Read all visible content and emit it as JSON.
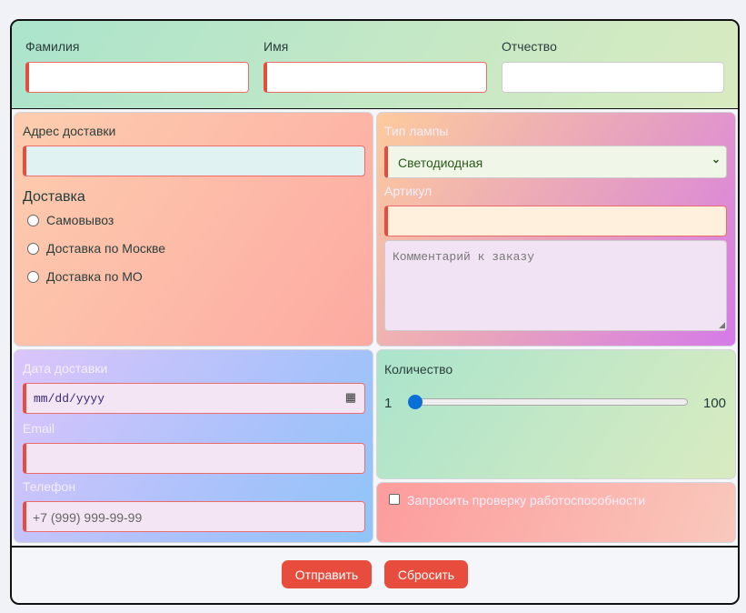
{
  "name": {
    "last_name_label": "Фамилия",
    "first_name_label": "Имя",
    "patronymic_label": "Отчество"
  },
  "delivery": {
    "address_label": "Адрес доставки",
    "method_title": "Доставка",
    "options": [
      "Самовывоз",
      "Доставка по Москве",
      "Доставка по МО"
    ]
  },
  "lamp": {
    "type_label": "Тип лампы",
    "type_value": "Светодиодная",
    "article_label": "Артикул",
    "comment_placeholder": "Комментарий к заказу"
  },
  "contact": {
    "date_label": "Дата доставки",
    "date_placeholder": "mm/dd/yyyy",
    "email_label": "Email",
    "phone_label": "Телефон",
    "phone_placeholder": "+7 (999) 999-99-99"
  },
  "quantity": {
    "label": "Количество",
    "min": "1",
    "max": "100",
    "value": 1
  },
  "check": {
    "label": "Запросить проверку работоспособности",
    "checked": false
  },
  "buttons": {
    "submit": "Отправить",
    "reset": "Сбросить"
  }
}
